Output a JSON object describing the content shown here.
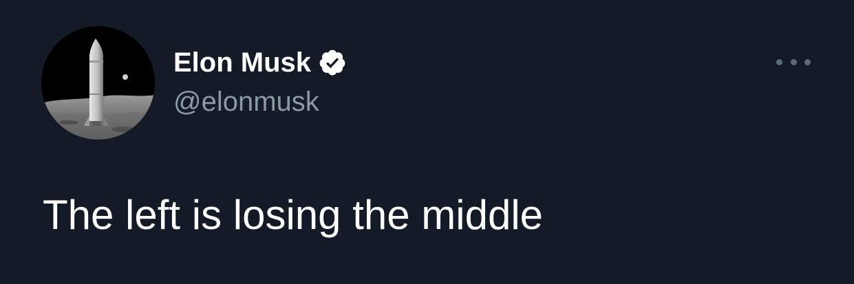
{
  "author": {
    "display_name": "Elon Musk",
    "handle": "@elonmusk",
    "verified": true,
    "avatar_icon": "rocket-on-moon-avatar"
  },
  "tweet": {
    "text": "The left is losing the middle"
  },
  "actions": {
    "more_icon": "more-options-icon"
  },
  "colors": {
    "background": "#151b26",
    "primary_text": "#ffffff",
    "secondary_text": "#8b98a5",
    "verified_badge": "#ffffff"
  }
}
